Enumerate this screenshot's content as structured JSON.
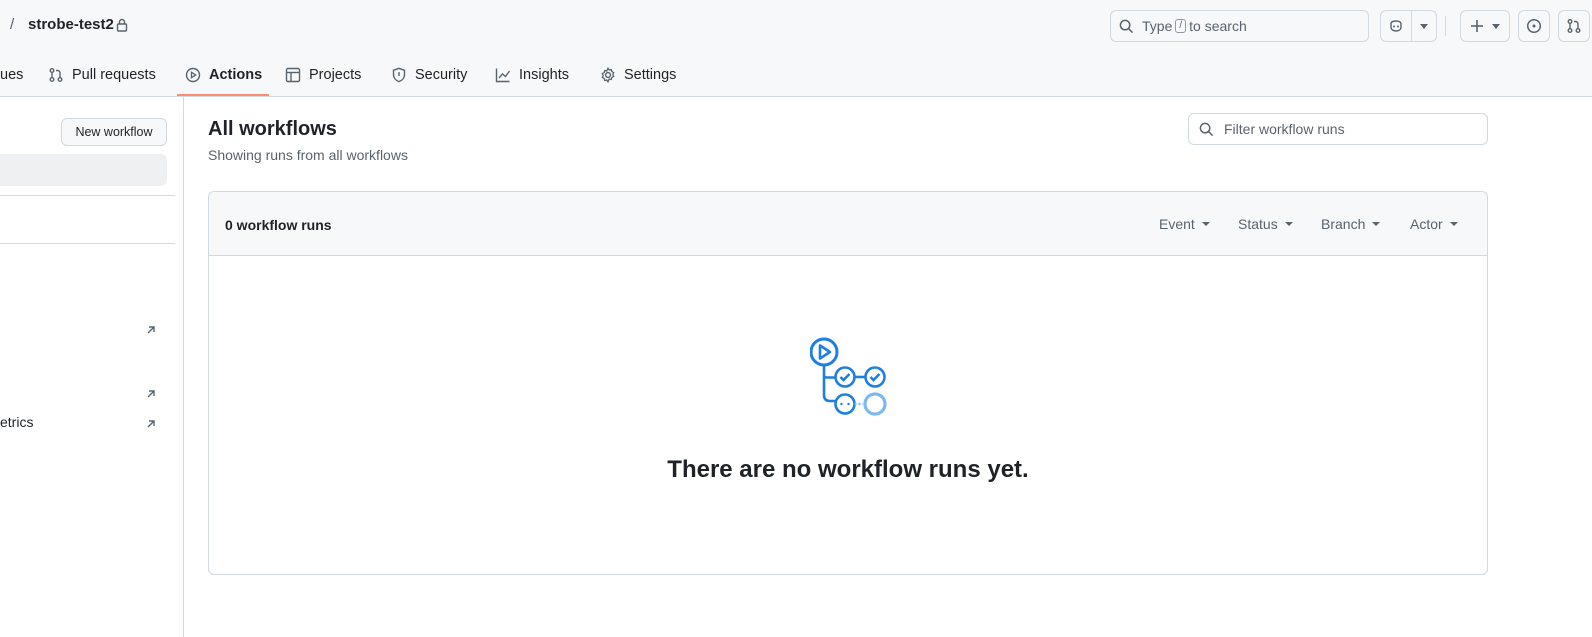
{
  "header": {
    "separator": "/",
    "repo_name": "strobe-test2",
    "search": {
      "prefix": "Type",
      "key": "/",
      "suffix": "to search"
    },
    "icons": [
      "lock-icon",
      "search-icon",
      "copilot-icon",
      "plus-icon",
      "issue-icon",
      "pull-request-icon"
    ]
  },
  "tabs": [
    {
      "label": "ues",
      "icon": "issue-icon"
    },
    {
      "label": "Pull requests",
      "icon": "git-pull-request-icon"
    },
    {
      "label": "Actions",
      "icon": "play-icon",
      "active": true
    },
    {
      "label": "Projects",
      "icon": "table-icon"
    },
    {
      "label": "Security",
      "icon": "shield-icon"
    },
    {
      "label": "Insights",
      "icon": "graph-icon"
    },
    {
      "label": "Settings",
      "icon": "gear-icon"
    }
  ],
  "sidebar": {
    "new_workflow_label": "New workflow",
    "metrics_label": "etrics"
  },
  "main": {
    "title": "All workflows",
    "subtitle": "Showing runs from all workflows",
    "filter_placeholder": "Filter workflow runs",
    "run_count": "0 workflow runs",
    "filters": [
      "Event",
      "Status",
      "Branch",
      "Actor"
    ],
    "empty_message": "There are no workflow runs yet."
  },
  "colors": {
    "accent_underline": "#fd8c73",
    "illustration_blue": "#1f7fe0",
    "illustration_light": "#7fb8f0"
  }
}
